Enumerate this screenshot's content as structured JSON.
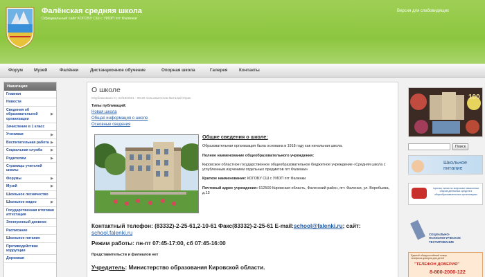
{
  "header": {
    "site_title": "Фалёнская средняя школа",
    "subtitle": "Официальный сайт КОГОБУ СШ с УИОП пгт Фаленки",
    "low_vision": "Версия для слабовидящих"
  },
  "nav": [
    "Форум",
    "Музей",
    "Фалёнки",
    "Дистанционное обучение",
    "Опорная школа",
    "Галерея",
    "Контакты"
  ],
  "sidebar": {
    "heading": "Навигация",
    "items": [
      {
        "label": "Главная",
        "arrow": false
      },
      {
        "label": "Новости",
        "arrow": false
      },
      {
        "label": "Сведения об образовательной организации",
        "arrow": true
      },
      {
        "label": "Зачисление в 1 класс",
        "arrow": false
      },
      {
        "label": "Ученикам",
        "arrow": true
      },
      {
        "label": "Воспитательная работа",
        "arrow": true
      },
      {
        "label": "Социальная служба",
        "arrow": true
      },
      {
        "label": "Родителям",
        "arrow": true
      },
      {
        "label": "Страницы учителей школы",
        "arrow": false
      },
      {
        "label": "Форумы",
        "arrow": true
      },
      {
        "label": "Музей",
        "arrow": true
      },
      {
        "label": "Школьное лесничество",
        "arrow": false
      },
      {
        "label": "Школьное видео",
        "arrow": true
      },
      {
        "label": "Государственная итоговая аттестация",
        "arrow": false
      },
      {
        "label": "Электронный дневник",
        "arrow": false
      },
      {
        "label": "Расписание",
        "arrow": false
      },
      {
        "label": "Школьное питание",
        "arrow": false
      },
      {
        "label": "Противодействие коррупции",
        "arrow": false
      },
      {
        "label": "Дорожная",
        "arrow": false
      }
    ]
  },
  "main": {
    "title": "О школе",
    "meta": "Опубликовано пт, 22/10/2021 - 09:20 пользователем Виталий Юрин",
    "pubs_label": "Типы публикаций:",
    "pub_links": [
      "Новая школа",
      "Общая информация о школе",
      "Основные сведения"
    ],
    "general_heading": "Общие сведения о школе:",
    "founded": "Образовательная организация была основана в 1918 году как начальная школа.",
    "full_name_label": "Полное наименование общеобразовательного учреждения:",
    "full_name": "Кировское областное государственное общеобразовательное бюджетное учреждение «Средняя школа с углубленным изучением отдельных предметов пгт Фаленки»",
    "short_name_label": "Краткое наименование:",
    "short_name": "КОГОБУ СШ с УИОП пгт Фаленки",
    "address_label": "Почтовый адрес учреждения:",
    "address": "612500 Кировская область, Фаленский район, пгт. Фаленки, ул. Воробьева, д.13",
    "phone_text": "Контактный телефон: (83332)-2-25-61,2-10-61 Факс(83332)-2-25-61 E-mail:",
    "email": "school@falenki.ru",
    "site_label": "сайт:",
    "site_value": "school.falenki.ru",
    "hours": "Режим работы: пн-пт 07:45-17:00, сб 07:45-16:00",
    "branches": "Представительств и филиалов нет",
    "founder_label": "Учредитель",
    "founder": "Министерство образования Кировской области."
  },
  "rightbar": {
    "search_button": "Поиск",
    "school_food": "Школьное питание",
    "hotline_text": "горячая линия по вопросам незаконных сборов денежных средств в общеобразовательных организациях",
    "psych_test": "СОЦИАЛЬНО-ПСИХОЛОГИЧЕСКОЕ ТЕСТИРОВАНИЕ",
    "trust_top": "Единый общероссийский номер телефона доверия для детей",
    "trust_name": "\"ТЕЛЕФОН ДОВЕРИЯ\"",
    "trust_phone": "8-800-2000-122"
  }
}
